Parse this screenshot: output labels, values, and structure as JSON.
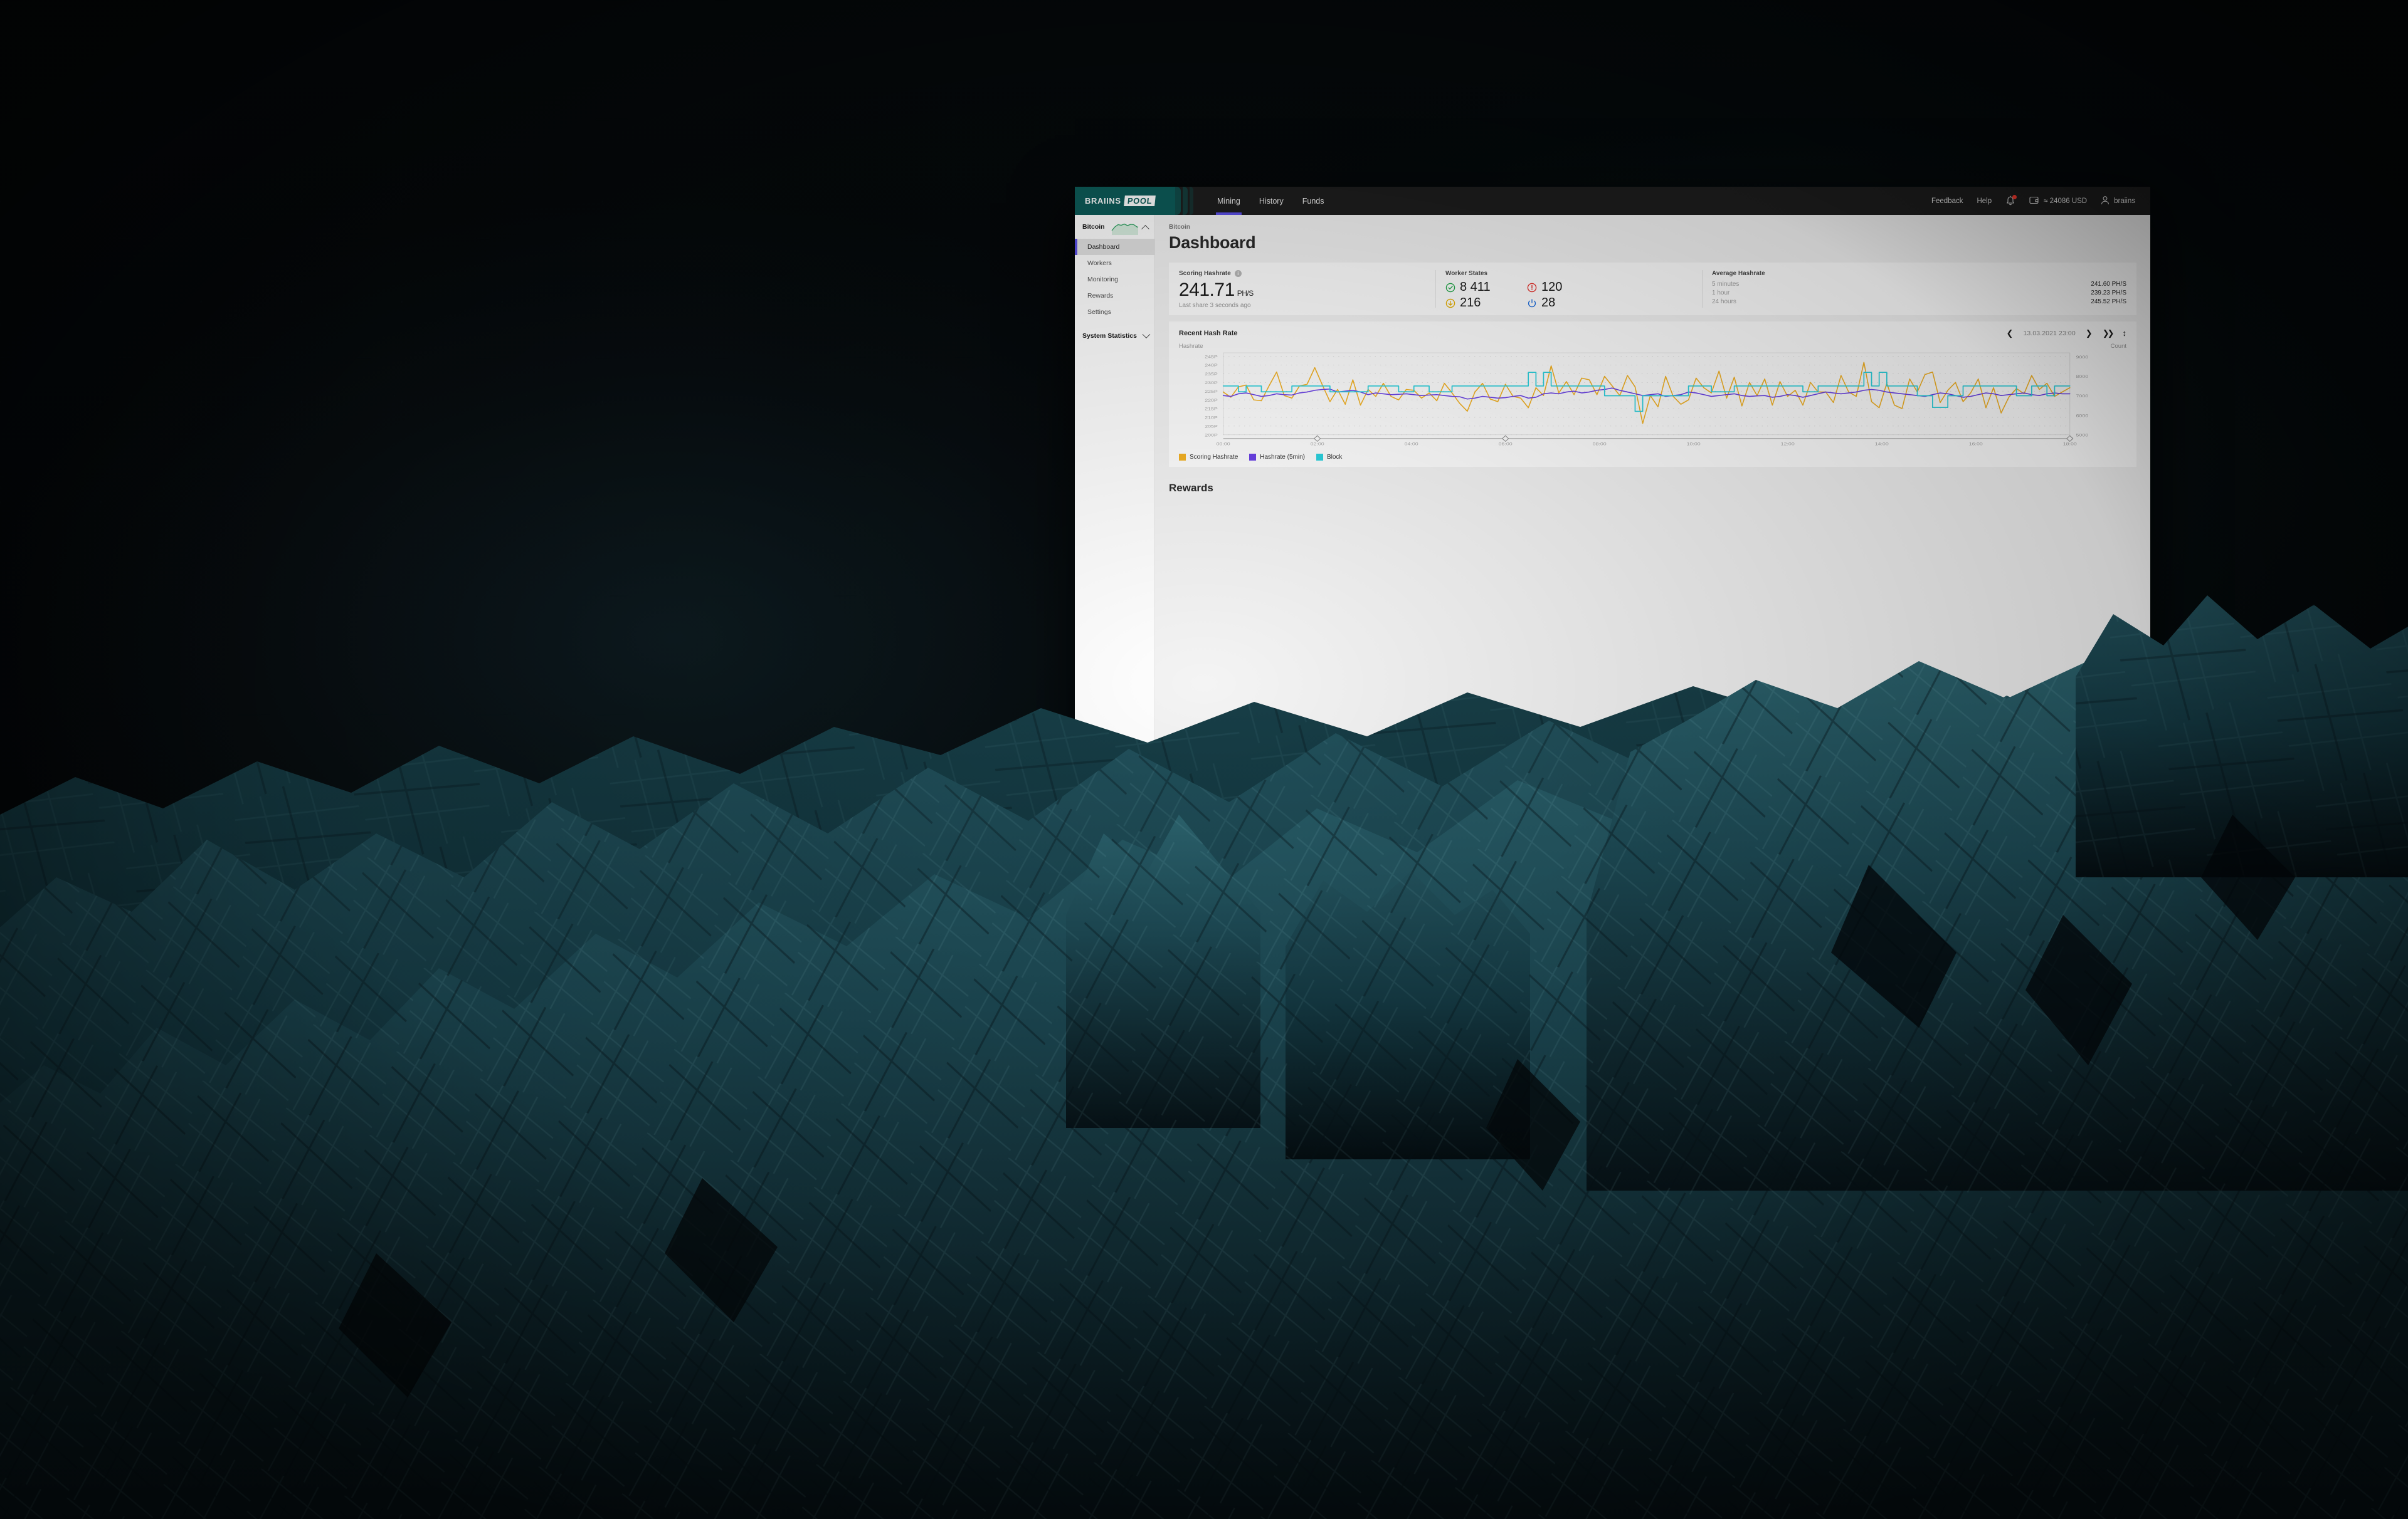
{
  "topbar": {
    "logo_primary": "BRAIINS",
    "logo_secondary": "POOL",
    "tabs": [
      {
        "label": "Mining",
        "active": true
      },
      {
        "label": "History",
        "active": false
      },
      {
        "label": "Funds",
        "active": false
      }
    ],
    "feedback_label": "Feedback",
    "help_label": "Help",
    "notification_icon": "bell-icon",
    "wallet_icon": "wallet-icon",
    "wallet_value": "≈ 24086 USD",
    "user_icon": "user-icon",
    "user_name": "braiins"
  },
  "sidebar": {
    "group_label": "Bitcoin",
    "group_chevron": "chevron-up-icon",
    "items": [
      {
        "label": "Dashboard",
        "active": true
      },
      {
        "label": "Workers",
        "active": false
      },
      {
        "label": "Monitoring",
        "active": false
      },
      {
        "label": "Rewards",
        "active": false
      },
      {
        "label": "Settings",
        "active": false
      }
    ],
    "stats_group_label": "System Statistics",
    "stats_group_chevron": "chevron-down-icon"
  },
  "main": {
    "breadcrumb": "Bitcoin",
    "page_title": "Dashboard",
    "rewards_title": "Rewards"
  },
  "scoring_hashrate_card": {
    "label": "Scoring Hashrate",
    "info_icon": "info-icon",
    "info_glyph": "i",
    "value": "241.71",
    "unit": "PH/S",
    "note": "Last share 3 seconds ago"
  },
  "worker_states_card": {
    "label": "Worker States",
    "states": [
      {
        "icon": "check-circle-icon",
        "value": "8 411",
        "color": "#21a849"
      },
      {
        "icon": "alert-circle-icon",
        "value": "120",
        "color": "#e8302a"
      },
      {
        "icon": "arrow-down-circle-icon",
        "value": "216",
        "color": "#e8b100"
      },
      {
        "icon": "power-icon",
        "value": "28",
        "color": "#1f6fe0"
      }
    ]
  },
  "average_hashrate_card": {
    "label": "Average Hashrate",
    "rows": [
      {
        "period": "5 minutes",
        "value": "241.60 PH/S"
      },
      {
        "period": "1 hour",
        "value": "239.23 PH/S"
      },
      {
        "period": "24 hours",
        "value": "245.52 PH/S"
      }
    ]
  },
  "chart_card": {
    "title": "Recent Hash Rate",
    "prev_icon": "chevron-left-icon",
    "prev_glyph": "❮",
    "date": "13.03.2021 23:00",
    "next_icon": "chevron-right-icon",
    "next_glyph": "❯",
    "fast_forward_icon": "chevrons-right-icon",
    "fast_forward_glyph": "❯❯",
    "resize_icon": "resize-vertical-icon",
    "resize_glyph": "↕"
  },
  "chart_data": {
    "type": "line",
    "title": "Recent Hash Rate",
    "xlabel": "",
    "ylabel": "Hashrate",
    "y2label": "Count",
    "ylim": [
      200,
      247
    ],
    "y2lim": [
      5000,
      9200
    ],
    "yticks": [
      "200P",
      "205P",
      "210P",
      "215P",
      "220P",
      "225P",
      "230P",
      "235P",
      "240P",
      "245P"
    ],
    "ytick_values": [
      200,
      205,
      210,
      215,
      220,
      225,
      230,
      235,
      240,
      245
    ],
    "y2ticks": [
      "5000",
      "6000",
      "7000",
      "8000",
      "9000"
    ],
    "y2tick_values": [
      5000,
      6000,
      7000,
      8000,
      9000
    ],
    "xticks": [
      "00:00",
      "02:00",
      "04:00",
      "06:00",
      "08:00",
      "10:00",
      "12:00",
      "14:00",
      "16:00",
      "18:00"
    ],
    "x_marker_positions": [
      "02:00",
      "06:00",
      "18:00"
    ],
    "x_marker_icon": "diamond-marker-icon",
    "grid": true,
    "legend_position": "bottom-left",
    "legend": [
      {
        "name": "Scoring Hashrate",
        "color": "#f5b324"
      },
      {
        "name": "Hashrate (5min)",
        "color": "#6b42e8"
      },
      {
        "name": "Block",
        "color": "#2bd3e0"
      }
    ],
    "series": [
      {
        "name": "Scoring Hashrate",
        "color": "#f5b324",
        "axis": "left",
        "values": [
          224.5,
          221.5,
          227.5,
          228.5,
          220.0,
          219.5,
          228.0,
          236.0,
          222.5,
          221.0,
          228.0,
          229.0,
          238.5,
          228.5,
          219.0,
          226.0,
          217.5,
          231.5,
          217.0,
          226.0,
          222.0,
          229.5,
          222.0,
          220.0,
          226.0,
          225.5,
          221.0,
          224.0,
          219.5,
          229.5,
          224.0,
          218.0,
          213.5,
          224.5,
          229.5,
          220.5,
          219.0,
          229.0,
          222.0,
          221.0,
          215.5,
          227.0,
          222.5,
          239.5,
          224.0,
          230.5,
          223.0,
          232.5,
          231.5,
          223.0,
          233.5,
          228.0,
          222.5,
          234.0,
          227.5,
          206.5,
          222.5,
          216.0,
          233.5,
          222.0,
          217.5,
          220.0,
          232.5,
          227.0,
          224.0,
          236.5,
          221.0,
          233.0,
          216.5,
          230.0,
          222.5,
          232.0,
          217.0,
          230.5,
          222.0,
          225.5,
          217.0,
          230.0,
          224.5,
          224.5,
          218.5,
          234.0,
          224.5,
          222.0,
          241.5,
          219.0,
          215.5,
          229.5,
          217.0,
          215.0,
          232.0,
          224.5,
          234.5,
          236.0,
          218.5,
          225.5,
          230.0,
          219.0,
          224.0,
          232.0,
          215.5,
          227.0,
          212.5,
          221.5,
          226.5,
          223.5,
          234.0,
          226.0,
          229.5,
          222.0,
          224.5,
          227.0
        ]
      },
      {
        "name": "Hashrate (5min)",
        "color": "#6b42e8",
        "axis": "left",
        "values": [
          222.5,
          222.0,
          223.5,
          224.0,
          223.0,
          222.0,
          222.5,
          223.5,
          223.0,
          222.8,
          224.0,
          224.5,
          225.5,
          226.0,
          226.2,
          224.5,
          225.0,
          225.5,
          224.5,
          223.0,
          224.0,
          223.5,
          223.0,
          223.2,
          223.5,
          223.0,
          222.5,
          222.8,
          223.0,
          222.5,
          222.0,
          221.8,
          220.5,
          221.0,
          222.0,
          221.5,
          221.0,
          221.3,
          222.0,
          222.5,
          221.0,
          221.5,
          223.5,
          224.0,
          223.5,
          224.5,
          225.0,
          224.0,
          224.5,
          225.5,
          226.0,
          226.8,
          225.5,
          224.5,
          223.5,
          222.5,
          223.0,
          223.5,
          222.0,
          222.5,
          223.0,
          224.5,
          224.0,
          223.0,
          222.0,
          222.5,
          223.0,
          223.5,
          222.5,
          222.0,
          222.3,
          222.5,
          221.5,
          222.0,
          223.0,
          222.5,
          221.5,
          222.5,
          223.5,
          224.5,
          224.0,
          223.5,
          224.0,
          224.5,
          225.5,
          226.0,
          225.5,
          224.5,
          224.0,
          223.5,
          223.0,
          222.5,
          222.0,
          223.0,
          224.0,
          223.5,
          222.5,
          221.5,
          222.0,
          223.0,
          224.0,
          223.5,
          222.5,
          223.0,
          223.5,
          224.0,
          223.0,
          222.5,
          223.5,
          224.0,
          223.5,
          223.5
        ]
      },
      {
        "name": "Block",
        "color": "#2bd3e0",
        "axis": "right",
        "step": true,
        "values": [
          7500,
          7500,
          7200,
          7500,
          7500,
          7200,
          7200,
          7200,
          7200,
          7500,
          7500,
          7500,
          7500,
          7500,
          7200,
          7200,
          7200,
          7200,
          7200,
          7500,
          7500,
          7500,
          7500,
          7200,
          7200,
          7500,
          7500,
          7200,
          7200,
          7200,
          7500,
          7500,
          7500,
          7500,
          7500,
          7500,
          7500,
          7500,
          7500,
          7500,
          8200,
          7500,
          8200,
          7500,
          7500,
          7500,
          7500,
          7500,
          7500,
          7500,
          7000,
          7000,
          7000,
          7000,
          6200,
          7000,
          7000,
          7000,
          7000,
          7000,
          7000,
          7500,
          7500,
          7500,
          7200,
          7200,
          7200,
          7500,
          7500,
          7500,
          7500,
          7500,
          7500,
          7500,
          7500,
          7500,
          7200,
          7200,
          7500,
          7500,
          7500,
          7500,
          7500,
          7500,
          8200,
          7500,
          8200,
          7500,
          7500,
          7500,
          7500,
          7000,
          7000,
          6400,
          6400,
          7000,
          7000,
          7500,
          7500,
          7500,
          7500,
          7500,
          7500,
          7500,
          7000,
          7000,
          7500,
          7500,
          7000,
          7500,
          7500,
          7500
        ]
      }
    ]
  },
  "colors": {
    "brand_teal": "#0d5c59",
    "accent_purple": "#5b50e8",
    "topbar_bg": "#1d1d1d",
    "page_bg": "#f4f4f4",
    "card_bg": "#ffffff"
  }
}
